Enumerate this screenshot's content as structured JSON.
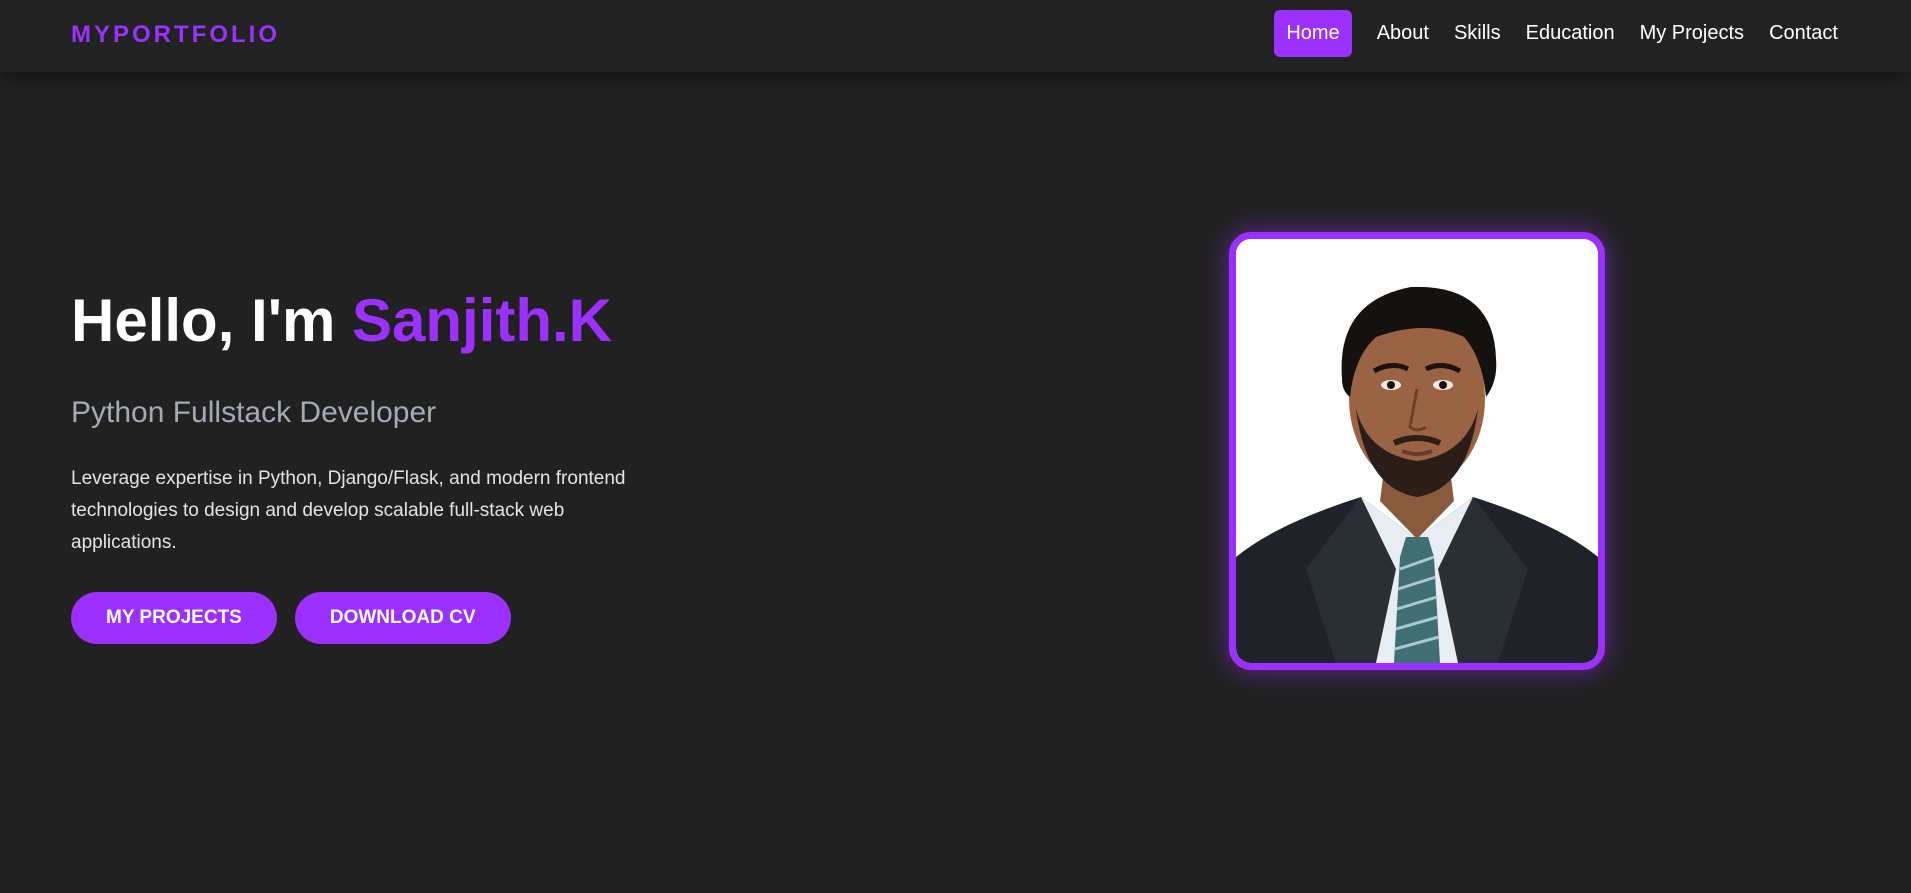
{
  "nav": {
    "logo": "MYPORTFOLIO",
    "links": [
      "Home",
      "About",
      "Skills",
      "Education",
      "My Projects",
      "Contact"
    ]
  },
  "hero": {
    "greeting": "Hello, I'm ",
    "name": "Sanjith.K",
    "role": "Python Fullstack Developer",
    "description": "Leverage expertise in Python, Django/Flask, and modern frontend technologies to design and develop scalable full-stack web applications.",
    "buttons": {
      "projects": "MY PROJECTS",
      "cv": "DOWNLOAD CV"
    }
  },
  "colors": {
    "accent": "#9b30ff",
    "background": "#212121",
    "navbar": "#222222"
  }
}
